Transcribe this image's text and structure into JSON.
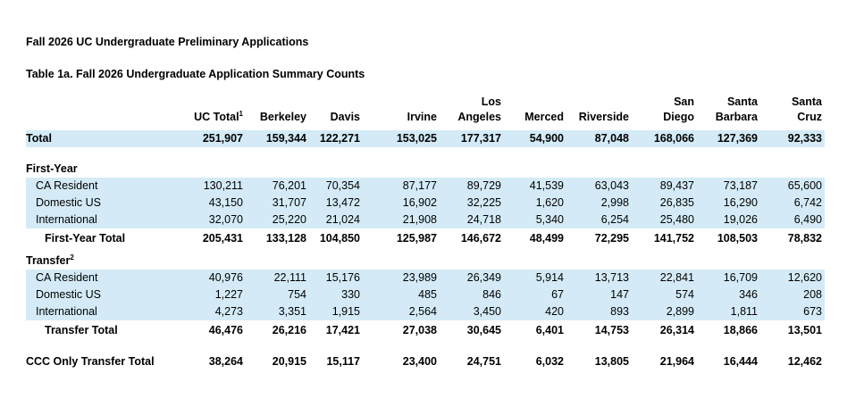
{
  "report_title": "Fall 2026 UC Undergraduate Preliminary Applications",
  "table_title": "Table 1a. Fall 2026 Undergraduate Application Summary Counts",
  "columns": [
    {
      "line1": "",
      "line2": "UC Total",
      "sup": "1"
    },
    {
      "line1": "",
      "line2": "Berkeley",
      "sup": ""
    },
    {
      "line1": "",
      "line2": "Davis",
      "sup": ""
    },
    {
      "line1": "",
      "line2": "Irvine",
      "sup": ""
    },
    {
      "line1": "Los",
      "line2": "Angeles",
      "sup": ""
    },
    {
      "line1": "",
      "line2": "Merced",
      "sup": ""
    },
    {
      "line1": "",
      "line2": "Riverside",
      "sup": ""
    },
    {
      "line1": "San",
      "line2": "Diego",
      "sup": ""
    },
    {
      "line1": "Santa",
      "line2": "Barbara",
      "sup": ""
    },
    {
      "line1": "Santa",
      "line2": "Cruz",
      "sup": ""
    }
  ],
  "total_row": {
    "label": "Total",
    "values": [
      "251,907",
      "159,344",
      "122,271",
      "153,025",
      "177,317",
      "54,900",
      "87,048",
      "168,066",
      "127,369",
      "92,333"
    ]
  },
  "first_year": {
    "heading": "First-Year",
    "heading_sup": "",
    "rows": [
      {
        "label": "CA Resident",
        "values": [
          "130,211",
          "76,201",
          "70,354",
          "87,177",
          "89,729",
          "41,539",
          "63,043",
          "89,437",
          "73,187",
          "65,600"
        ]
      },
      {
        "label": "Domestic US",
        "values": [
          "43,150",
          "31,707",
          "13,472",
          "16,902",
          "32,225",
          "1,620",
          "2,998",
          "26,835",
          "16,290",
          "6,742"
        ]
      },
      {
        "label": "International",
        "values": [
          "32,070",
          "25,220",
          "21,024",
          "21,908",
          "24,718",
          "5,340",
          "6,254",
          "25,480",
          "19,026",
          "6,490"
        ]
      }
    ],
    "total": {
      "label": "First-Year Total",
      "values": [
        "205,431",
        "133,128",
        "104,850",
        "125,987",
        "146,672",
        "48,499",
        "72,295",
        "141,752",
        "108,503",
        "78,832"
      ]
    }
  },
  "transfer": {
    "heading": "Transfer",
    "heading_sup": "2",
    "rows": [
      {
        "label": "CA Resident",
        "values": [
          "40,976",
          "22,111",
          "15,176",
          "23,989",
          "26,349",
          "5,914",
          "13,713",
          "22,841",
          "16,709",
          "12,620"
        ]
      },
      {
        "label": "Domestic US",
        "values": [
          "1,227",
          "754",
          "330",
          "485",
          "846",
          "67",
          "147",
          "574",
          "346",
          "208"
        ]
      },
      {
        "label": "International",
        "values": [
          "4,273",
          "3,351",
          "1,915",
          "2,564",
          "3,450",
          "420",
          "893",
          "2,899",
          "1,811",
          "673"
        ]
      }
    ],
    "total": {
      "label": "Transfer Total",
      "values": [
        "46,476",
        "26,216",
        "17,421",
        "27,038",
        "30,645",
        "6,401",
        "14,753",
        "26,314",
        "18,866",
        "13,501"
      ]
    }
  },
  "ccc_row": {
    "label": "CCC Only Transfer Total",
    "values": [
      "38,264",
      "20,915",
      "15,117",
      "23,400",
      "24,751",
      "6,032",
      "13,805",
      "21,964",
      "16,444",
      "12,462"
    ]
  }
}
